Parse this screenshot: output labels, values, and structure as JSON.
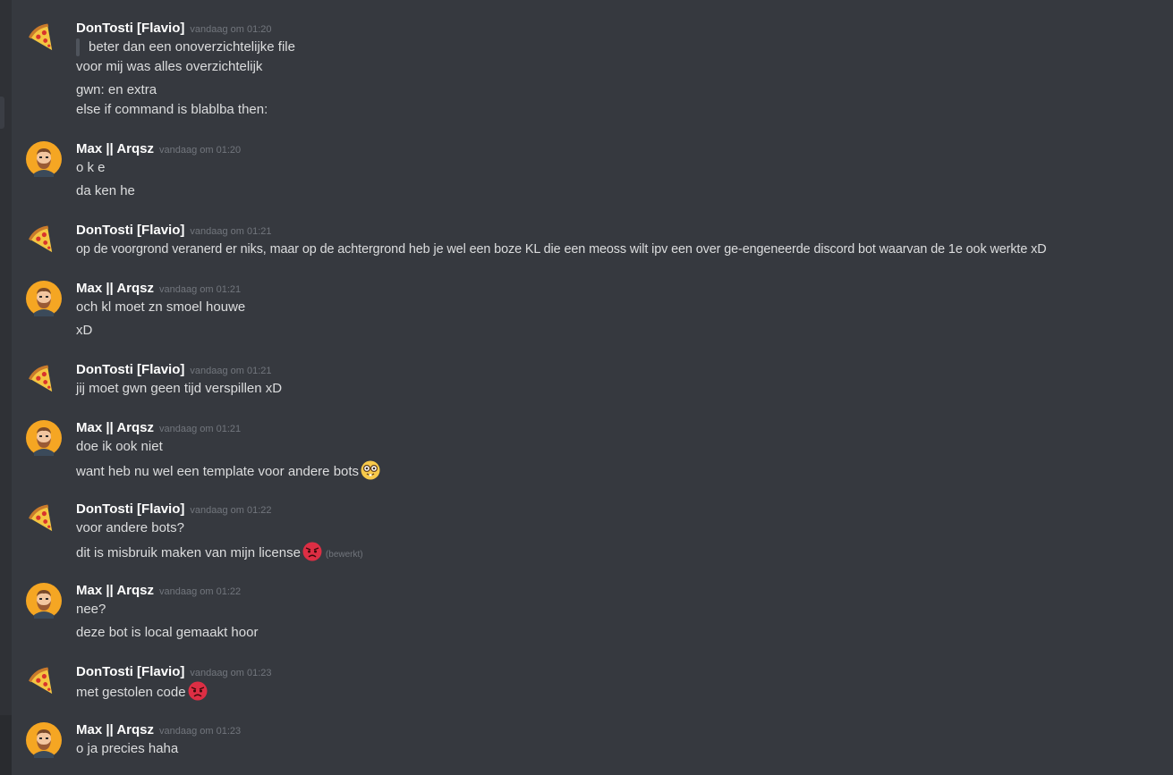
{
  "users": {
    "flavio": {
      "name": "DonTosti [Flavio]"
    },
    "max": {
      "name": "Max || Arqsz"
    }
  },
  "messages": [
    {
      "user": "DonTosti [Flavio]",
      "time": "vandaag om 01:20",
      "quote": "beter dan een onoverzichtelijke file",
      "lines": [
        "voor mij was alles overzichtelijk",
        "gwn: en extra",
        "else if command is blablba then:"
      ]
    },
    {
      "user": "Max || Arqsz",
      "time": "vandaag om 01:20",
      "lines": [
        "o k e",
        "da ken he"
      ]
    },
    {
      "user": "DonTosti [Flavio]",
      "time": "vandaag om 01:21",
      "lines": [
        "op de voorgrond veranerd er niks, maar op de achtergrond heb je wel een boze KL die een meoss wilt ipv een over ge-engeneerde discord bot waarvan de 1e ook werkte xD"
      ]
    },
    {
      "user": "Max || Arqsz",
      "time": "vandaag om 01:21",
      "lines": [
        "och kl moet zn smoel houwe",
        "xD"
      ]
    },
    {
      "user": "DonTosti [Flavio]",
      "time": "vandaag om 01:21",
      "lines": [
        "jij moet gwn geen tijd verspillen xD"
      ]
    },
    {
      "user": "Max || Arqsz",
      "time": "vandaag om 01:21",
      "lines": [
        "doe ik ook niet",
        "want heb nu wel een template voor andere bots"
      ]
    },
    {
      "user": "DonTosti [Flavio]",
      "time": "vandaag om 01:22",
      "lines": [
        "voor andere bots?",
        "dit is misbruik maken van mijn license"
      ],
      "edited": "(bewerkt)"
    },
    {
      "user": "Max || Arqsz",
      "time": "vandaag om 01:22",
      "lines": [
        "nee?",
        "deze bot is local gemaakt hoor"
      ]
    },
    {
      "user": "DonTosti [Flavio]",
      "time": "vandaag om 01:23",
      "lines": [
        "met gestolen code"
      ]
    },
    {
      "user": "Max || Arqsz",
      "time": "vandaag om 01:23",
      "lines": [
        "o ja precies haha"
      ]
    }
  ],
  "icons": {
    "flavio_avatar": "pizza-icon",
    "max_avatar": "bearded-man-avatar",
    "nerd_emoji": "nerd-face-emoji",
    "angry_emoji": "angry-face-emoji"
  },
  "colors": {
    "background": "#36393f",
    "username": "#ffffff",
    "text": "#dcddde",
    "timestamp": "#72767d",
    "max_avatar_bg": "#f5a623"
  }
}
